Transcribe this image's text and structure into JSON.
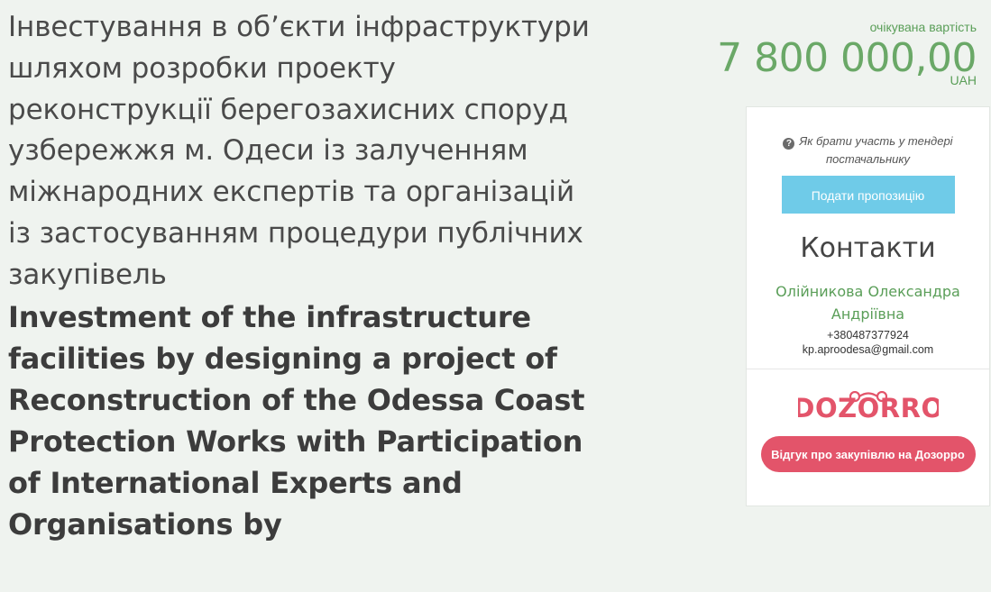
{
  "tender": {
    "title_uk": "Інвестування в об’єкти інфраструктури шляхом розробки проекту реконструкції берегозахисних споруд узбережжя м. Одеси із залученням міжнародних експертів та організацій із застосуванням процедури публічних закупівель",
    "title_en": "Investment of the infrastructure facilities by designing a project of Reconstruction of the Odessa Coast Protection Works with Participation of International Experts and Organisations by"
  },
  "value": {
    "label": "очікувана вартість",
    "amount": "7 800 000,00",
    "currency": "UAH"
  },
  "sidebar": {
    "help_text": "Як брати участь у тендері постачальнику",
    "help_icon": "question-circle-icon",
    "submit_label": "Подати пропозицію",
    "contacts_heading": "Контакти",
    "contact_name": "Олійникова Олександра Андріївна",
    "contact_phone": "+380487377924",
    "contact_email": "kp.aproodesa@gmail.com",
    "dozorro_logo_text": "DOZORRO",
    "dozorro_button": "Відгук про закупівлю на Дозорро"
  },
  "colors": {
    "background": "#eff3ef",
    "accent_green": "#6aa867",
    "submit_blue": "#6fcbe8",
    "dozorro_red": "#e3546a"
  }
}
